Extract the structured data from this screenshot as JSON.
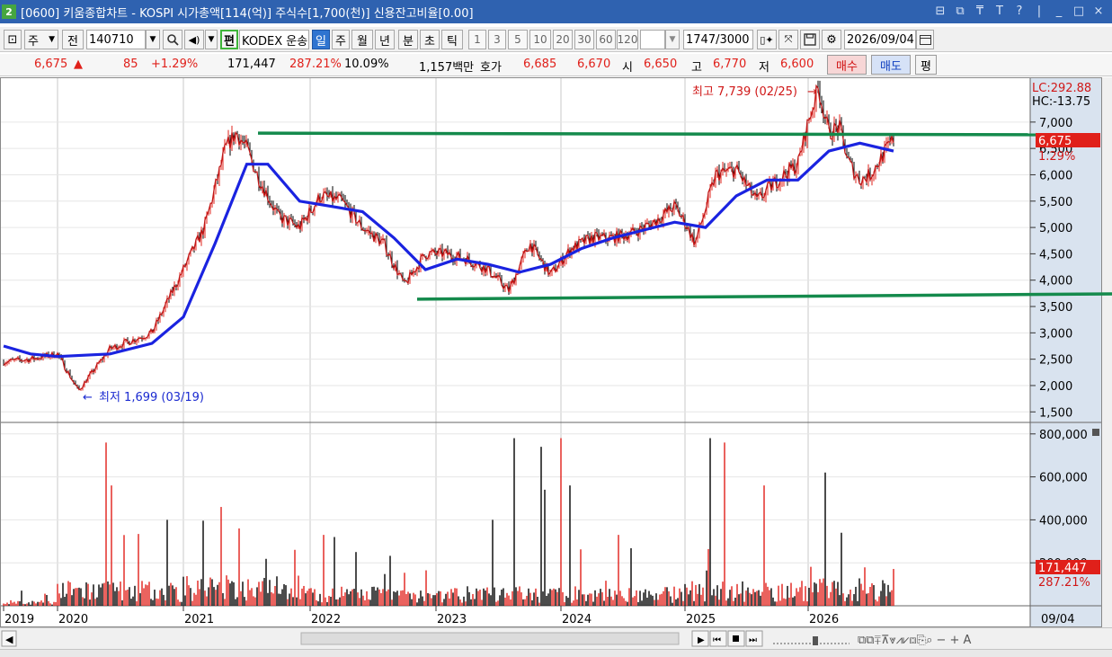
{
  "window": {
    "badge": "2",
    "title": "[0600] 키움종합차트 - KOSPI 시가총액[114(억)] 주식수[1,700(천)] 신용잔고비율[0.00]",
    "buttons": [
      "⊟",
      "⧉",
      "₸",
      "T",
      "?",
      "|",
      "_",
      "□",
      "×"
    ]
  },
  "toolbar": {
    "layout_icon": "⊡",
    "market": "주",
    "prev": "전",
    "code": "140710",
    "name": "KODEX 운송",
    "edit": "편",
    "periods": [
      "일",
      "주",
      "월",
      "년",
      "분",
      "초",
      "틱"
    ],
    "selected_period": "일",
    "intervals": [
      "1",
      "3",
      "5",
      "10",
      "20",
      "30",
      "60",
      "120"
    ],
    "count": "1747",
    "max_count": "/3000",
    "date": "2026/09/04"
  },
  "quote": {
    "price": "6,675",
    "arrow": "▲",
    "change": "85",
    "change_pct": "+1.29%",
    "volume": "171,447",
    "volume_ratio": "287.21%",
    "turnover": "10.09%",
    "amount": "1,157백만",
    "ask_label": "호가",
    "ask": "6,685",
    "bid": "6,670",
    "open_label": "시",
    "open": "6,650",
    "high_label": "고",
    "high": "6,770",
    "low_label": "저",
    "low": "6,600",
    "buy": "매수",
    "sell": "매도",
    "eval": "평"
  },
  "price_axis": {
    "lc": "LC:292.88",
    "hc": "HC:-13.75",
    "ticks": [
      "7,000",
      "6,500",
      "6,000",
      "5,500",
      "5,000",
      "4,500",
      "4,000",
      "3,500",
      "3,000",
      "2,500",
      "2,000",
      "1,500"
    ],
    "last_price": "6,675",
    "last_pct": "1.29%"
  },
  "volume_axis": {
    "ticks": [
      "800,000",
      "600,000",
      "400,000",
      "200,000"
    ],
    "last_volume": "171,447",
    "last_pct": "287.21%"
  },
  "annotations": {
    "high": "최고 7,739 (02/25)",
    "low": "최저 1,699 (03/19)"
  },
  "x_axis": {
    "years": [
      "2019",
      "2020",
      "2021",
      "2022",
      "2023",
      "2024",
      "2025",
      "2026"
    ],
    "end_label": "09/04"
  },
  "colors": {
    "title_bar": "#2f62b0",
    "up": "#e0201a",
    "down": "#000000",
    "ma": "#1a23e0",
    "trendline": "#148a4c",
    "axis_bg": "#d9e3ef",
    "price_tag": "#e0201a"
  },
  "chart_data": [
    {
      "type": "line",
      "title": "",
      "series": [
        {
          "name": "",
          "x": [
            "2019-01",
            "2019-07",
            "2020-01",
            "2020-03",
            "2020-06",
            "2020-10",
            "2021-01",
            "2021-03",
            "2021-05",
            "2021-06",
            "2021-07",
            "2021-08",
            "2021-10",
            "2021-12",
            "2022-02",
            "2022-04",
            "2022-06",
            "2022-08",
            "2022-10",
            "2022-12",
            "2023-02",
            "2023-04",
            "2023-06",
            "2023-08",
            "2023-10",
            "2023-12",
            "2024-02",
            "2024-04",
            "2024-06",
            "2024-08",
            "2024-10",
            "2024-12",
            "2025-01",
            "2025-02",
            "2025-04",
            "2025-06",
            "2025-08",
            "2025-10",
            "2025-12",
            "2026-01",
            "2026-02",
            "2026-03",
            "2026-04",
            "2026-05",
            "2026-06",
            "2026-07",
            "2026-08",
            "2026-09"
          ],
          "values": [
            2450,
            2500,
            2600,
            1900,
            2700,
            3000,
            4200,
            5000,
            6500,
            6800,
            6500,
            6000,
            5200,
            5000,
            5600,
            5500,
            5000,
            4700,
            3900,
            4500,
            4500,
            4400,
            4200,
            3800,
            4700,
            4100,
            4600,
            4800,
            4800,
            4900,
            5100,
            5400,
            5100,
            4700,
            6000,
            6100,
            5500,
            5900,
            6200,
            7000,
            7650,
            6800,
            6900,
            6200,
            5900,
            6000,
            6300,
            6675
          ]
        },
        {
          "name": "",
          "x": [
            "2019-01",
            "2019-07",
            "2020-01",
            "2020-06",
            "2020-10",
            "2021-01",
            "2021-04",
            "2021-07",
            "2021-09",
            "2021-12",
            "2022-03",
            "2022-06",
            "2022-09",
            "2022-12",
            "2023-03",
            "2023-06",
            "2023-09",
            "2023-12",
            "2024-03",
            "2024-06",
            "2024-09",
            "2024-12",
            "2025-03",
            "2025-06",
            "2025-09",
            "2025-12",
            "2026-03",
            "2026-06",
            "2026-09"
          ],
          "values": [
            2750,
            2600,
            2550,
            2600,
            2800,
            3300,
            4700,
            6200,
            6200,
            5500,
            5400,
            5300,
            4800,
            4200,
            4400,
            4300,
            4150,
            4300,
            4600,
            4800,
            4950,
            5100,
            5000,
            5600,
            5900,
            5900,
            6450,
            6600,
            6450
          ]
        }
      ],
      "ylim": [
        1300,
        7850
      ],
      "xlim": [
        "2019-01",
        "2026-09"
      ],
      "annotations": [
        "최고 7,739 (02/25)",
        "최저 1,699 (03/19)"
      ]
    },
    {
      "type": "bar",
      "title": "",
      "ylim": [
        0,
        820000
      ],
      "x": [
        "2019",
        "2020",
        "2021",
        "2022",
        "2023",
        "2024",
        "2025",
        "2026"
      ],
      "series": [
        {
          "name": "",
          "peaks": [
            40000,
            760000,
            560000,
            460000,
            780000,
            740000,
            780000,
            600000
          ],
          "typical": [
            20000,
            90000,
            110000,
            70000,
            70000,
            70000,
            90000,
            100000
          ]
        }
      ],
      "last_value": 171447
    }
  ]
}
